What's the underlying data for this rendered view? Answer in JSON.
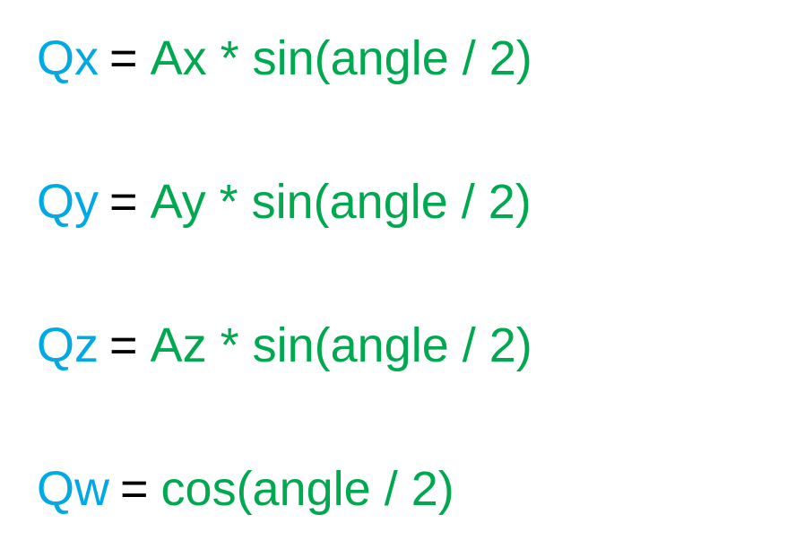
{
  "colors": {
    "lhs": "#00a9e6",
    "equals": "#000000",
    "rhs": "#00a84f",
    "background": "#ffffff"
  },
  "equations": [
    {
      "lhs": "Qx",
      "equals": "=",
      "rhs": "Ax * sin(angle / 2)"
    },
    {
      "lhs": "Qy",
      "equals": "=",
      "rhs": "Ay * sin(angle / 2)"
    },
    {
      "lhs": "Qz",
      "equals": "=",
      "rhs": "Az * sin(angle / 2)"
    },
    {
      "lhs": "Qw",
      "equals": "=",
      "rhs": "cos(angle / 2)"
    }
  ]
}
